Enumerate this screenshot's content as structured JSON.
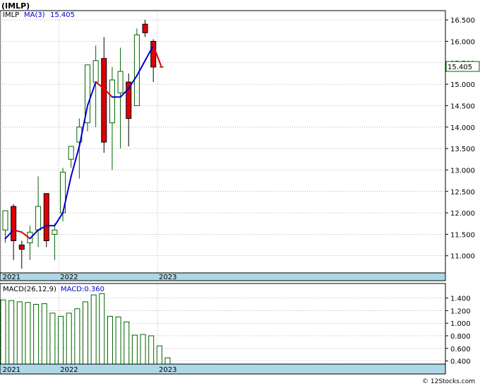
{
  "title": "(IMLP)",
  "watermark": "© 12Stocks.com",
  "colors": {
    "up_body": "#ffffff",
    "up_outline": "#006400",
    "down_body": "#e00000",
    "ma_up": "#0000cc",
    "ma_down": "#e00000",
    "macd_bar": "#006400",
    "axis_band": "#add8e6",
    "grid": "#999999"
  },
  "chart_data": [
    {
      "type": "candlestick",
      "legend": {
        "symbol": "IMLP",
        "ma_label": "MA(3)",
        "ma_value": "15.405"
      },
      "last_price_label": "15.405",
      "ylim": [
        10.6,
        16.7
      ],
      "y_ticks": [
        "16.500",
        "16.000",
        "15.500",
        "15.000",
        "14.500",
        "14.000",
        "13.500",
        "13.000",
        "12.500",
        "12.000",
        "11.500",
        "11.000"
      ],
      "x_labels": [
        {
          "label": "2021",
          "index": 0
        },
        {
          "label": "2022",
          "index": 7
        },
        {
          "label": "2023",
          "index": 19
        }
      ],
      "candles": [
        {
          "o": 11.6,
          "h": 11.8,
          "l": 11.3,
          "c": 12.05
        },
        {
          "o": 12.15,
          "h": 12.2,
          "l": 10.9,
          "c": 11.35
        },
        {
          "o": 11.25,
          "h": 11.35,
          "l": 10.7,
          "c": 11.15
        },
        {
          "o": 11.3,
          "h": 11.7,
          "l": 10.9,
          "c": 11.55
        },
        {
          "o": 11.6,
          "h": 12.85,
          "l": 11.2,
          "c": 12.15
        },
        {
          "o": 12.45,
          "h": 12.45,
          "l": 11.2,
          "c": 11.35
        },
        {
          "o": 11.5,
          "h": 11.75,
          "l": 10.9,
          "c": 11.6
        },
        {
          "o": 12.0,
          "h": 13.05,
          "l": 11.8,
          "c": 12.95
        },
        {
          "o": 13.25,
          "h": 13.5,
          "l": 13.05,
          "c": 13.55
        },
        {
          "o": 13.65,
          "h": 14.2,
          "l": 12.8,
          "c": 14.0
        },
        {
          "o": 14.1,
          "h": 15.4,
          "l": 13.9,
          "c": 15.45
        },
        {
          "o": 15.05,
          "h": 15.9,
          "l": 14.0,
          "c": 15.55
        },
        {
          "o": 15.6,
          "h": 16.1,
          "l": 13.4,
          "c": 13.65
        },
        {
          "o": 14.1,
          "h": 15.4,
          "l": 13.0,
          "c": 15.1
        },
        {
          "o": 14.8,
          "h": 15.85,
          "l": 13.5,
          "c": 15.3
        },
        {
          "o": 15.05,
          "h": 15.25,
          "l": 13.55,
          "c": 14.2
        },
        {
          "o": 14.5,
          "h": 16.3,
          "l": 14.5,
          "c": 16.15
        },
        {
          "o": 16.4,
          "h": 16.5,
          "l": 16.1,
          "c": 16.2
        },
        {
          "o": 16.0,
          "h": 16.05,
          "l": 15.05,
          "c": 15.4
        },
        {
          "o": 15.4,
          "h": 15.4,
          "l": 15.4,
          "c": 15.4
        }
      ],
      "ma_series": [
        11.4,
        11.6,
        11.55,
        11.4,
        11.6,
        11.7,
        11.7,
        12.0,
        12.85,
        13.55,
        14.5,
        15.05,
        14.9,
        14.7,
        14.7,
        14.9,
        15.2,
        15.55,
        15.9,
        15.4
      ]
    },
    {
      "type": "bar",
      "legend": {
        "name": "MACD(26,12,9)",
        "value_label": "MACD:0.360"
      },
      "ylim": [
        0.35,
        1.62
      ],
      "y_ticks": [
        "1.400",
        "1.200",
        "1.000",
        "0.800",
        "0.600",
        "0.400"
      ],
      "x_labels": [
        {
          "label": "2021",
          "index": 0
        },
        {
          "label": "2022",
          "index": 7
        },
        {
          "label": "2023",
          "index": 19
        }
      ],
      "values": [
        1.37,
        1.36,
        1.34,
        1.33,
        1.3,
        1.31,
        1.16,
        1.11,
        1.16,
        1.23,
        1.34,
        1.45,
        1.47,
        1.11,
        1.1,
        1.02,
        0.81,
        0.82,
        0.8,
        0.64,
        0.45
      ]
    }
  ]
}
